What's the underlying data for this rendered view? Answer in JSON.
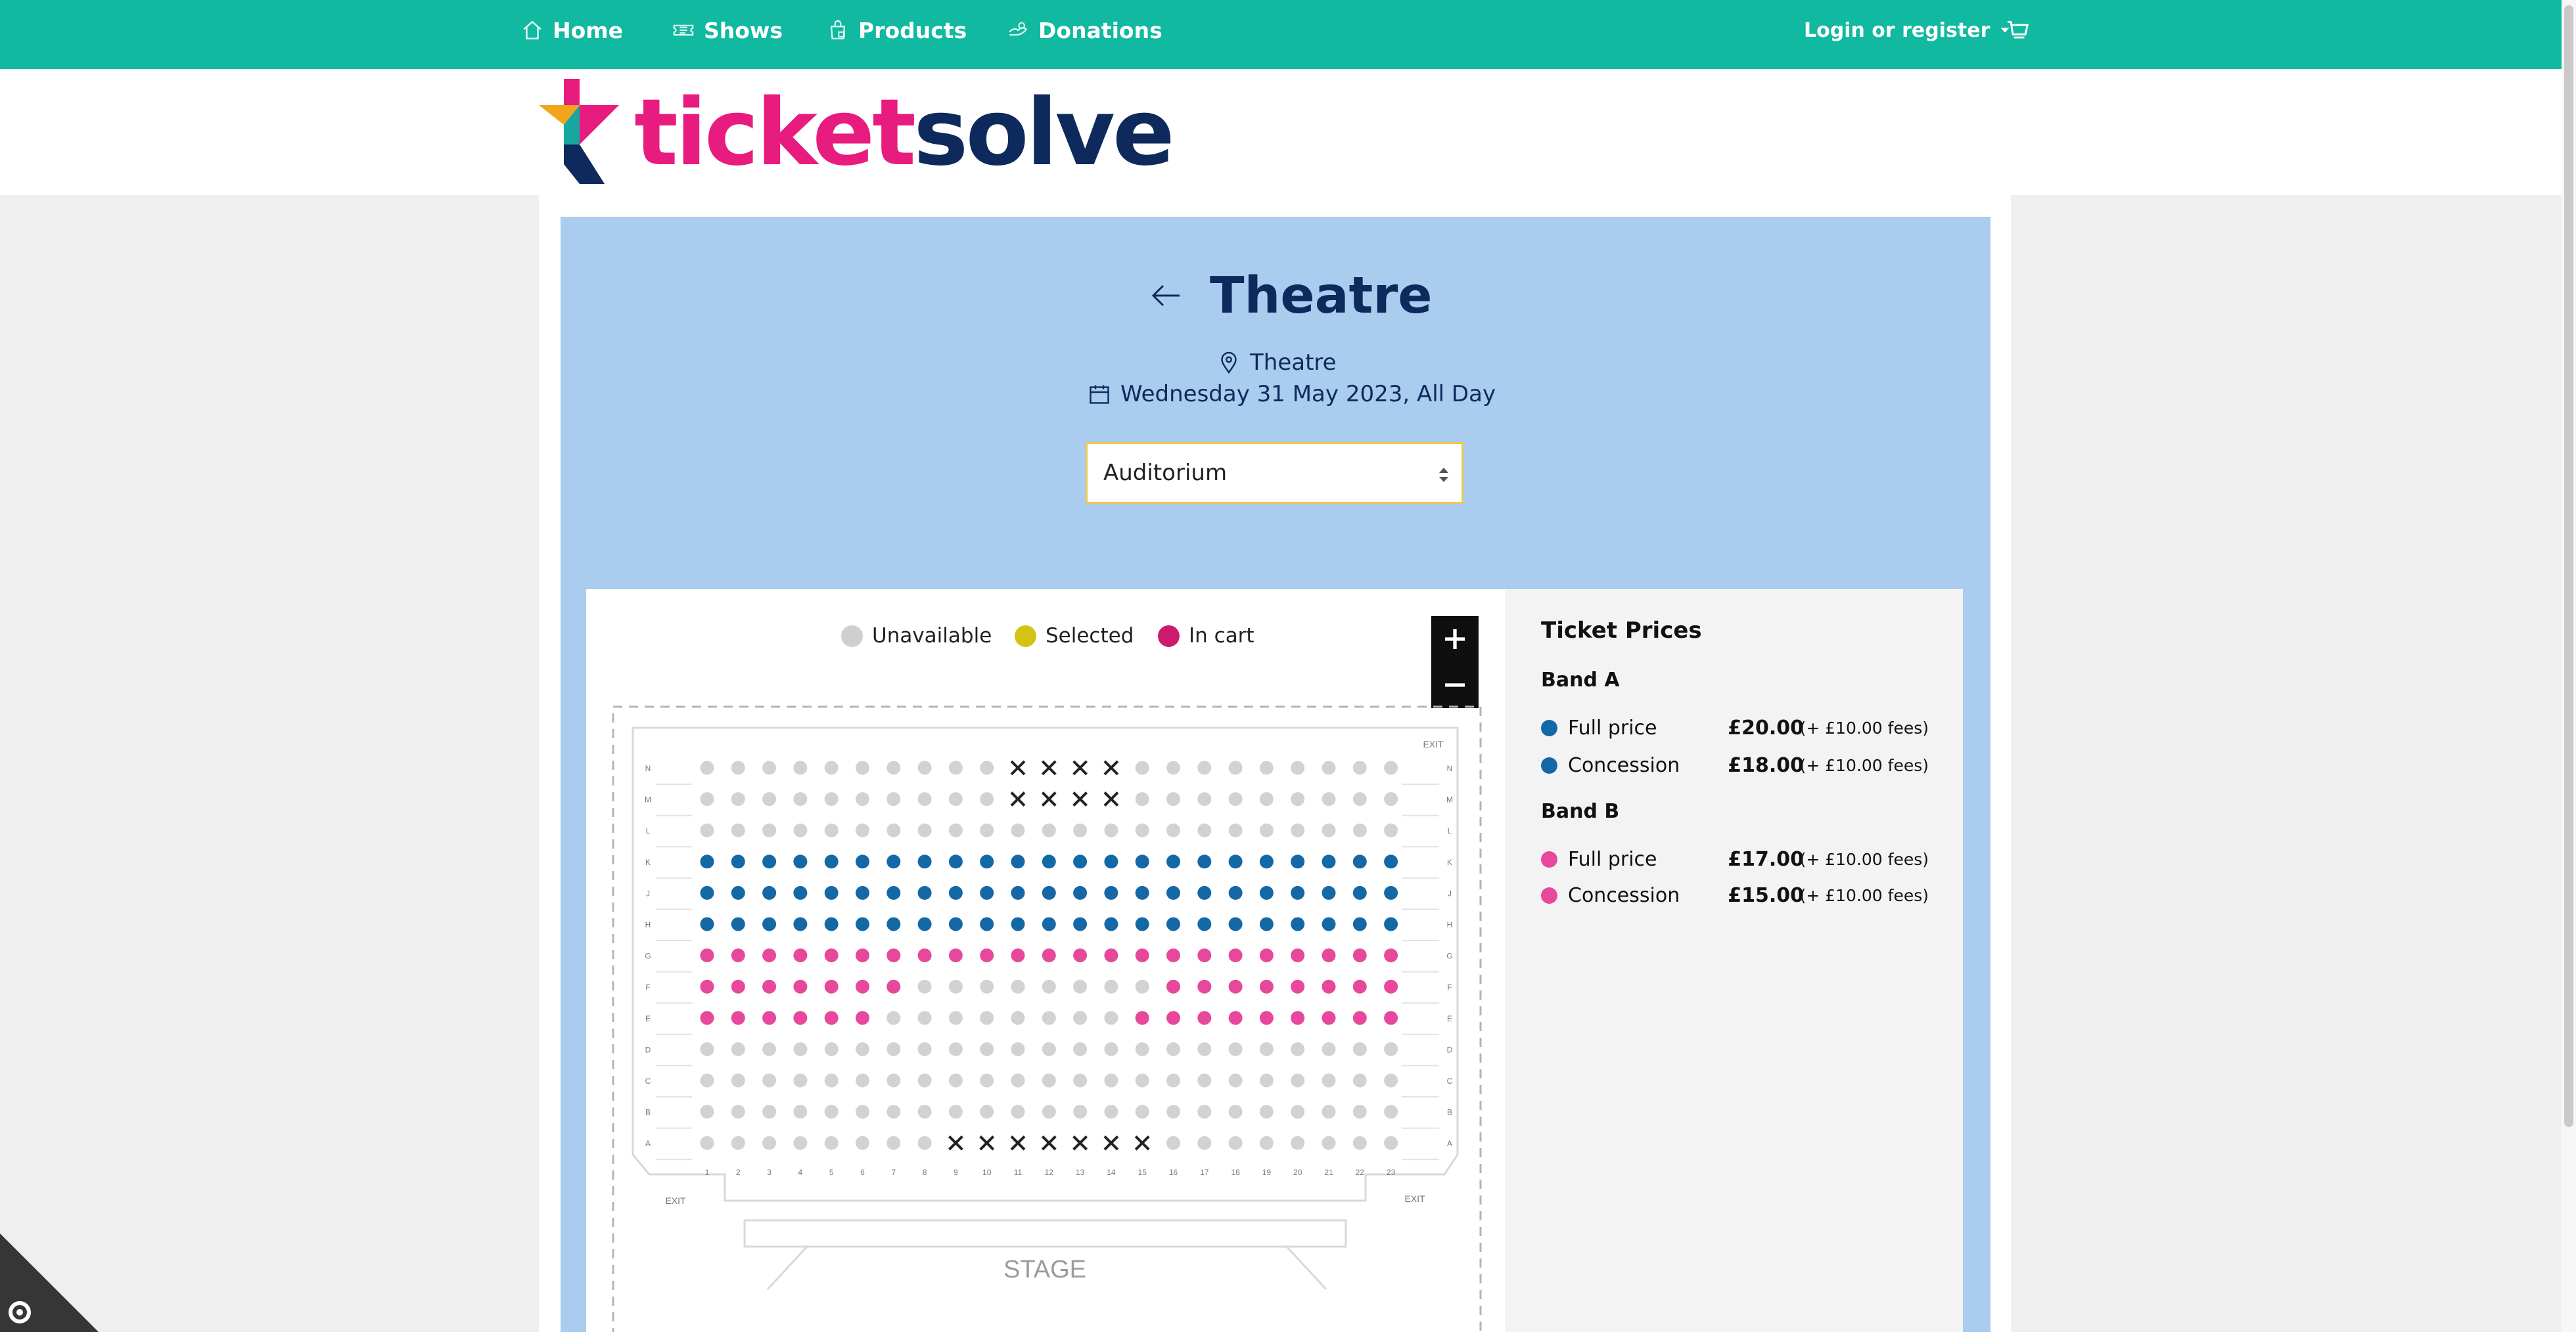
{
  "nav": {
    "items": [
      {
        "label": "Home",
        "icon": "home-icon"
      },
      {
        "label": "Shows",
        "icon": "ticket-icon"
      },
      {
        "label": "Products",
        "icon": "bag-icon"
      },
      {
        "label": "Donations",
        "icon": "donation-icon"
      }
    ],
    "login_label": "Login or register",
    "cart_icon": "cart-icon"
  },
  "brand": {
    "logo_part1": "ticket",
    "logo_part2": "solve"
  },
  "event": {
    "title": "Theatre",
    "venue": "Theatre",
    "date": "Wednesday 31 May 2023, All Day"
  },
  "area_select": {
    "selected": "Auditorium"
  },
  "legend": {
    "unavailable": "Unavailable",
    "selected": "Selected",
    "in_cart": "In cart"
  },
  "zoom": {
    "in": "+",
    "out": "−"
  },
  "prices": {
    "title": "Ticket Prices",
    "bands": [
      {
        "name": "Band A",
        "color": "#1468a6",
        "rows": [
          {
            "label": "Full price",
            "price": "£20.00",
            "fees": "(+ £10.00 fees)"
          },
          {
            "label": "Concession",
            "price": "£18.00",
            "fees": "(+ £10.00 fees)"
          }
        ]
      },
      {
        "name": "Band B",
        "color": "#e7489b",
        "rows": [
          {
            "label": "Full price",
            "price": "£17.00",
            "fees": "(+ £10.00 fees)"
          },
          {
            "label": "Concession",
            "price": "£15.00",
            "fees": "(+ £10.00 fees)"
          }
        ]
      }
    ]
  },
  "seatmap": {
    "rows": [
      "N",
      "M",
      "L",
      "K",
      "J",
      "H",
      "G",
      "F",
      "E",
      "D",
      "C",
      "B",
      "A"
    ],
    "seat_numbers": [
      "1",
      "2",
      "3",
      "4",
      "5",
      "6",
      "7",
      "8",
      "9",
      "10",
      "11",
      "12",
      "13",
      "14",
      "15",
      "16",
      "17",
      "18",
      "19",
      "20",
      "21",
      "22",
      "23"
    ],
    "stage_label": "STAGE",
    "exit_label": "EXIT",
    "colors": {
      "unavailable": "#d2d2d2",
      "band_a": "#1468a6",
      "band_b": "#e7489b",
      "selected": "#d4c317",
      "in_cart": "#cc1a6e"
    },
    "layout": [
      "UUUUUUUUUUXXXXUUUUUUUUU",
      "UUUUUUUUUUXXXXUUUUUUUUU",
      "UUUUUUUUUUUUUUUUUUUUUUU",
      "AAAAAAAAAAAAAAAAAAAAAAA",
      "AAAAAAAAAAAAAAAAAAAAAAA",
      "AAAAAAAAAAAAAAAAAAAAAAA",
      "BBBBBBBBBBBBBBBBBBBBBBB",
      "BBBBBBBUUUUUUUUBBBBBBBB",
      "BBBBBBUUUUUUUUBBBBBBBBB",
      "UUUUUUUUUUUUUUUUUUUUUUU",
      "UUUUUUUUUUUUUUUUUUUUUUU",
      "UUUUUUUUUUUUUUUUUUUUUUU",
      "UUUUUUUUXXXXXXXUUUUUUUU"
    ]
  }
}
